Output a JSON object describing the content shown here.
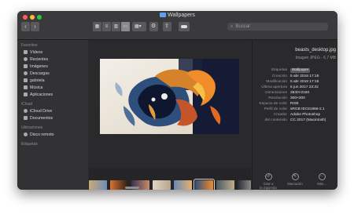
{
  "window": {
    "title": "Wallpapers"
  },
  "toolbar": {
    "back_icon": "chevron-left",
    "forward_icon": "chevron-right",
    "search_placeholder": "Buscar"
  },
  "sidebar": {
    "sections": [
      {
        "label": "Favoritos",
        "items": [
          "Vídeos",
          "Recientes",
          "Imágenes",
          "Descargas",
          "gabriela",
          "Música",
          "Aplicaciones"
        ]
      },
      {
        "label": "iCloud",
        "items": [
          "iCloud Drive",
          "Documentos"
        ]
      },
      {
        "label": "Ubicaciones",
        "items": [
          "Disco remoto"
        ]
      },
      {
        "label": "Etiquetas",
        "items": []
      }
    ]
  },
  "info": {
    "filename": "beasts_desktop.jpg",
    "subtitle": "Imagen JPEG - 6,7 MB",
    "rows": [
      {
        "k": "Etiquetas",
        "v": "Wallpaper"
      },
      {
        "k": "Creación",
        "v": "5 abr 2018 17:18"
      },
      {
        "k": "Modificación",
        "v": "5 abr 2018 17:18"
      },
      {
        "k": "Última apertura",
        "v": "5 jun 2017 23:32"
      },
      {
        "k": "Dimensiones",
        "v": "3840×2160"
      },
      {
        "k": "Resolución",
        "v": "300×300"
      },
      {
        "k": "Espacio de color",
        "v": "RGB"
      },
      {
        "k": "Perfil de color",
        "v": "sRGB IEC61966-2.1"
      },
      {
        "k": "Creador",
        "v": "Adobe Photoshop"
      },
      {
        "k": "del contenido",
        "v": "CC 2017 (Macintosh)"
      }
    ],
    "actions": [
      {
        "label1": "Girar a",
        "label2": "la izquierda",
        "icon": "rotate-left"
      },
      {
        "label1": "Marcación",
        "label2": "",
        "icon": "markup"
      },
      {
        "label1": "Más...",
        "label2": "",
        "icon": "more"
      }
    ]
  },
  "colors": {
    "accent": "#5aa3e6",
    "window_bg": "#2b2b2d",
    "sidebar_bg": "#323234"
  }
}
